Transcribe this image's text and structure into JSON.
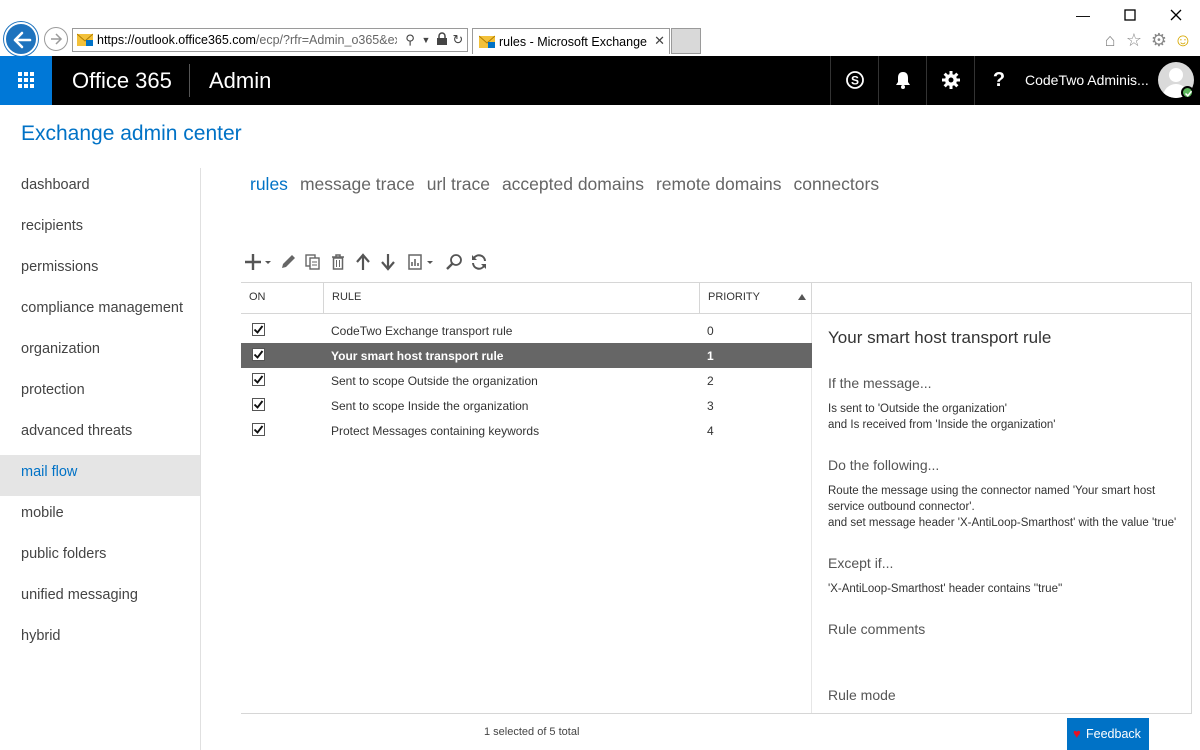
{
  "browser": {
    "url_host": "https://outlook.office365.com",
    "url_path": "/ecp/?rfr=Admin_o365&ex",
    "tab_title": "rules - Microsoft Exchange"
  },
  "o365": {
    "brand": "Office 365",
    "app": "Admin",
    "user": "CodeTwo Adminis...",
    "help_glyph": "?"
  },
  "page": {
    "title": "Exchange admin center"
  },
  "nav": [
    {
      "label": "dashboard"
    },
    {
      "label": "recipients"
    },
    {
      "label": "permissions"
    },
    {
      "label": "compliance management"
    },
    {
      "label": "organization"
    },
    {
      "label": "protection"
    },
    {
      "label": "advanced threats"
    },
    {
      "label": "mail flow",
      "selected": true
    },
    {
      "label": "mobile"
    },
    {
      "label": "public folders"
    },
    {
      "label": "unified messaging"
    },
    {
      "label": "hybrid"
    }
  ],
  "tabs": [
    {
      "label": "rules",
      "active": true
    },
    {
      "label": "message trace"
    },
    {
      "label": "url trace"
    },
    {
      "label": "accepted domains"
    },
    {
      "label": "remote domains"
    },
    {
      "label": "connectors"
    }
  ],
  "toolbar": [
    "add-icon",
    "edit-icon",
    "copy-icon",
    "delete-icon",
    "move-up-icon",
    "move-down-icon",
    "report-icon",
    "search-icon",
    "refresh-icon"
  ],
  "grid": {
    "col_on": "ON",
    "col_rule": "RULE",
    "col_priority": "PRIORITY",
    "rows": [
      {
        "on": true,
        "name": "CodeTwo Exchange transport rule",
        "priority": "0"
      },
      {
        "on": true,
        "name": "Your smart host transport rule",
        "priority": "1",
        "selected": true
      },
      {
        "on": true,
        "name": "Sent to scope Outside the organization",
        "priority": "2"
      },
      {
        "on": true,
        "name": "Sent to scope Inside the organization",
        "priority": "3"
      },
      {
        "on": true,
        "name": "Protect Messages containing keywords",
        "priority": "4"
      }
    ],
    "status": "1 selected of 5 total"
  },
  "details": {
    "title": "Your smart host transport rule",
    "if_heading": "If the message...",
    "if_line1": "Is sent to 'Outside the organization'",
    "if_line2": "and Is received from 'Inside the organization'",
    "do_heading": "Do the following...",
    "do_line1": "Route the message using the connector named 'Your smart host",
    "do_line2": "service outbound connector'.",
    "do_line3": "and set message header 'X-AntiLoop-Smarthost' with the value 'true'",
    "except_heading": "Except if...",
    "except_line1": "'X-AntiLoop-Smarthost' header contains ''true''",
    "comments_heading": "Rule comments",
    "mode_heading": "Rule mode"
  },
  "feedback": {
    "label": "Feedback"
  },
  "colors": {
    "accent": "#0072c6",
    "waffle": "#0078d7",
    "selected_row": "#666666",
    "header_bg": "#000000"
  }
}
